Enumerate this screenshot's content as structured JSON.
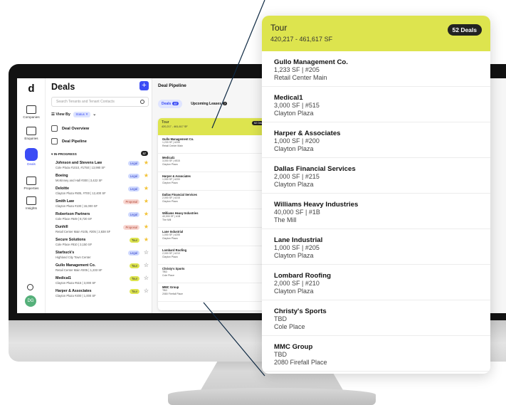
{
  "app": {
    "logo": "d",
    "nav": [
      {
        "label": "Companies",
        "icon": "building-icon",
        "active": false
      },
      {
        "label": "Enquiries",
        "icon": "document-icon",
        "active": false
      },
      {
        "label": "Deals",
        "icon": "deals-icon",
        "active": true
      },
      {
        "label": "Properties",
        "icon": "properties-icon",
        "active": false
      },
      {
        "label": "Insights",
        "icon": "insights-icon",
        "active": false
      }
    ],
    "user_initials": "DG"
  },
  "panel": {
    "title": "Deals",
    "add_label": "+",
    "search_placeholder": "Search Tenants and Tenant Contacts",
    "view_by_label": "View By",
    "status_chip": "Status ✕",
    "deal_overview": "Deal Overview",
    "deal_pipeline": "Deal Pipeline",
    "group_label": "IN-PROGRESS",
    "group_count": "37",
    "deals": [
      {
        "name": "Johnson and Stevens Law",
        "sub": "Cole Plaza #1010, #1750 | 13,990 SF",
        "tag": "Legal",
        "tag_type": "legal",
        "starred": true
      },
      {
        "name": "Boeing",
        "sub": "McKinney and Hall #300 | 3,422 SF",
        "tag": "Legal",
        "tag_type": "legal",
        "starred": true
      },
      {
        "name": "Deloitte",
        "sub": "Clayton Plaza #505, #700 | 12,400 SF",
        "tag": "Legal",
        "tag_type": "legal",
        "starred": true
      },
      {
        "name": "Smith Law",
        "sub": "Clayton Plaza #100 | 15,000 SF",
        "tag": "Proposal",
        "tag_type": "proposal",
        "starred": true
      },
      {
        "name": "Robertson Partners",
        "sub": "Cole Place #649 | 8,720 SF",
        "tag": "Legal",
        "tag_type": "legal",
        "starred": true
      },
      {
        "name": "Dunhill",
        "sub": "Retail Center Main #105, #205 | 2,838 SF",
        "tag": "Proposal",
        "tag_type": "proposal",
        "starred": true
      },
      {
        "name": "Secure Solutions",
        "sub": "Cole Place #810 | 3,150 SF",
        "tag": "Tour",
        "tag_type": "tour",
        "starred": true
      },
      {
        "name": "Starbuck's",
        "sub": "Highland City Town Center",
        "tag": "Legal",
        "tag_type": "legal",
        "starred": false
      },
      {
        "name": "Gullo Management Co.",
        "sub": "Retail Center Main #205 | 1,233 SF",
        "tag": "Tour",
        "tag_type": "tour",
        "starred": false
      },
      {
        "name": "Medical1",
        "sub": "Clayton Plaza #515 | 3,000 SF",
        "tag": "Tour",
        "tag_type": "tour",
        "starred": false
      },
      {
        "name": "Harper & Associates",
        "sub": "Clayton Plaza #200 | 1,000 SF",
        "tag": "Tour",
        "tag_type": "tour",
        "starred": false
      }
    ]
  },
  "pipeline": {
    "title": "Deal Pipeline",
    "tab_deals": "Deals",
    "tab_deals_count": "37",
    "tab_leases": "Upcoming Leases",
    "tab_leases_count": "7"
  },
  "column": {
    "title": "Tour",
    "range": "420,217 - 461,617 SF",
    "count": "52 Deals",
    "cards": [
      {
        "name": "Gullo Management Co.",
        "line1": "1,233 SF | #205",
        "line2": "Retail Center Main"
      },
      {
        "name": "Medical1",
        "line1": "3,000 SF | #515",
        "line2": "Clayton Plaza"
      },
      {
        "name": "Harper & Associates",
        "line1": "1,000 SF | #200",
        "line2": "Clayton Plaza"
      },
      {
        "name": "Dallas Financial Services",
        "line1": "2,000 SF | #215",
        "line2": "Clayton Plaza"
      },
      {
        "name": "Williams Heavy Industries",
        "line1": "40,000 SF | #1B",
        "line2": "The Mill"
      },
      {
        "name": "Lane Industrial",
        "line1": "1,000 SF | #205",
        "line2": "Clayton Plaza"
      },
      {
        "name": "Lombard Roofing",
        "line1": "2,000 SF | #210",
        "line2": "Clayton Plaza"
      },
      {
        "name": "Christy's Sports",
        "line1": "TBD",
        "line2": "Cole Place"
      },
      {
        "name": "MMC Group",
        "line1": "TBD",
        "line2": "2080 Firefall Place"
      }
    ]
  },
  "colors": {
    "accent": "#3b4cf5",
    "tour_yellow": "#dde44e",
    "legal_blue": "#cfd9ff",
    "proposal_pink": "#f8d7d2",
    "star": "#f2c235"
  }
}
